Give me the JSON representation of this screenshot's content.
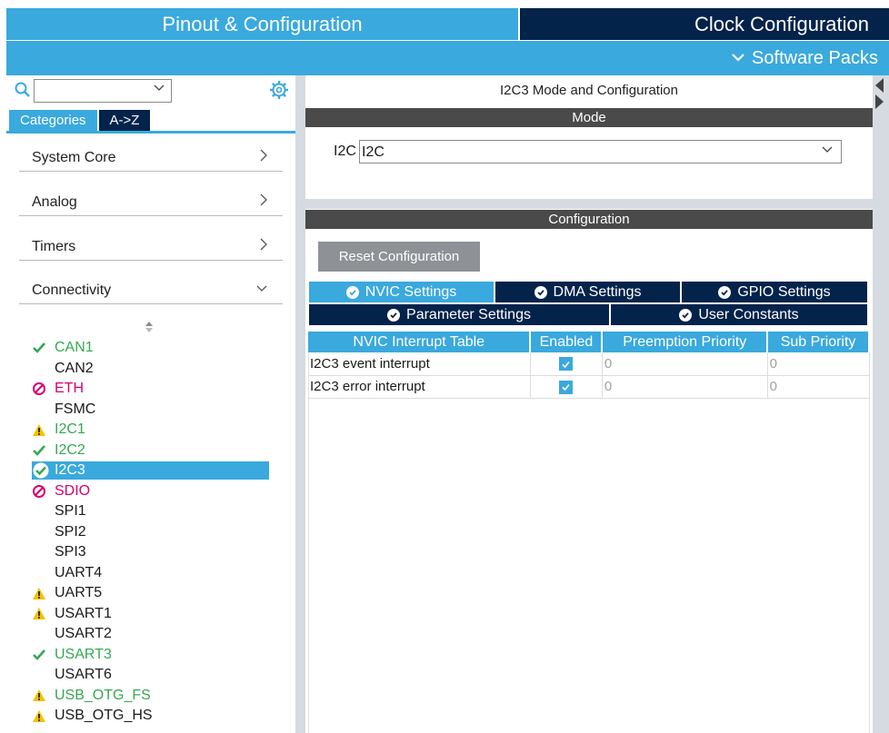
{
  "top_tabs": {
    "pinout": "Pinout & Configuration",
    "clock": "Clock Configuration",
    "software_packs": "Software Packs"
  },
  "left": {
    "search": {
      "value": ""
    },
    "tabs": {
      "categories": "Categories",
      "az": "A->Z"
    },
    "categories": [
      {
        "label": "System Core",
        "arrow": ">"
      },
      {
        "label": "Analog",
        "arrow": ">"
      },
      {
        "label": "Timers",
        "arrow": ">"
      },
      {
        "label": "Connectivity",
        "arrow": "v"
      }
    ],
    "peripherals": [
      {
        "name": "CAN1",
        "status": "ok"
      },
      {
        "name": "CAN2",
        "status": "none"
      },
      {
        "name": "ETH",
        "status": "blocked"
      },
      {
        "name": "FSMC",
        "status": "none"
      },
      {
        "name": "I2C1",
        "status": "warn-green"
      },
      {
        "name": "I2C2",
        "status": "ok"
      },
      {
        "name": "I2C3",
        "status": "selected"
      },
      {
        "name": "SDIO",
        "status": "blocked"
      },
      {
        "name": "SPI1",
        "status": "none"
      },
      {
        "name": "SPI2",
        "status": "none"
      },
      {
        "name": "SPI3",
        "status": "none"
      },
      {
        "name": "UART4",
        "status": "none"
      },
      {
        "name": "UART5",
        "status": "warn"
      },
      {
        "name": "USART1",
        "status": "warn"
      },
      {
        "name": "USART2",
        "status": "none"
      },
      {
        "name": "USART3",
        "status": "ok"
      },
      {
        "name": "USART6",
        "status": "none"
      },
      {
        "name": "USB_OTG_FS",
        "status": "warn-green"
      },
      {
        "name": "USB_OTG_HS",
        "status": "warn"
      }
    ]
  },
  "right": {
    "title": "I2C3 Mode and Configuration",
    "mode_header": "Mode",
    "i2c_label": "I2C",
    "i2c_value": "I2C",
    "config_header": "Configuration",
    "reset_button": "Reset Configuration",
    "tabs": {
      "nvic": "NVIC Settings",
      "dma": "DMA Settings",
      "gpio": "GPIO Settings",
      "param": "Parameter Settings",
      "user": "User Constants"
    },
    "table": {
      "headers": [
        "NVIC Interrupt Table",
        "Enabled",
        "Preemption Priority",
        "Sub Priority"
      ],
      "rows": [
        {
          "name": "I2C3 event interrupt",
          "enabled": true,
          "preemption": "0",
          "sub": "0"
        },
        {
          "name": "I2C3 error interrupt",
          "enabled": true,
          "preemption": "0",
          "sub": "0"
        }
      ]
    }
  },
  "colors": {
    "accent": "#3aa9dd",
    "dark": "#03234b",
    "ok_green": "#34a853",
    "blocked_pink": "#d6006f",
    "warn_yellow": "#f2c200"
  }
}
